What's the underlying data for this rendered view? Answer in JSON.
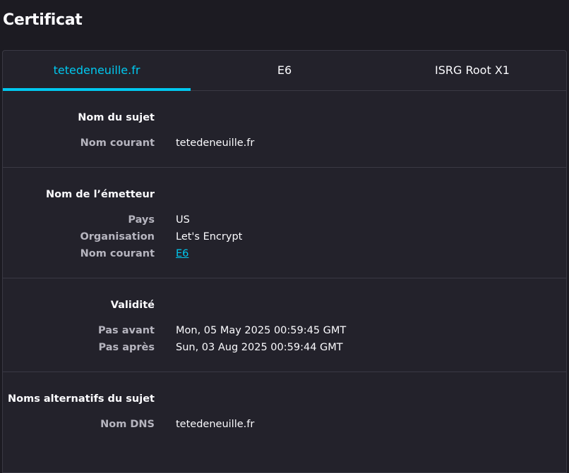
{
  "page": {
    "title": "Certificat"
  },
  "tabs": [
    {
      "label": "tetedeneuille.fr",
      "active": true
    },
    {
      "label": "E6",
      "active": false
    },
    {
      "label": "ISRG Root X1",
      "active": false
    }
  ],
  "subject": {
    "heading": "Nom du sujet",
    "common_name_label": "Nom courant",
    "common_name_value": "tetedeneuille.fr"
  },
  "issuer": {
    "heading": "Nom de l’émetteur",
    "country_label": "Pays",
    "country_value": "US",
    "organization_label": "Organisation",
    "organization_value": "Let's Encrypt",
    "common_name_label": "Nom courant",
    "common_name_value": "E6"
  },
  "validity": {
    "heading": "Validité",
    "not_before_label": "Pas avant",
    "not_before_value": "Mon, 05 May 2025 00:59:45 GMT",
    "not_after_label": "Pas après",
    "not_after_value": "Sun, 03 Aug 2025 00:59:44 GMT"
  },
  "san": {
    "heading": "Noms alternatifs du sujet",
    "dns_label": "Nom DNS",
    "dns_value": "tetedeneuille.fr"
  },
  "colors": {
    "background": "#1c1b22",
    "panel": "#23222b",
    "accent": "#00c8ef",
    "label": "#b6b5bf"
  }
}
